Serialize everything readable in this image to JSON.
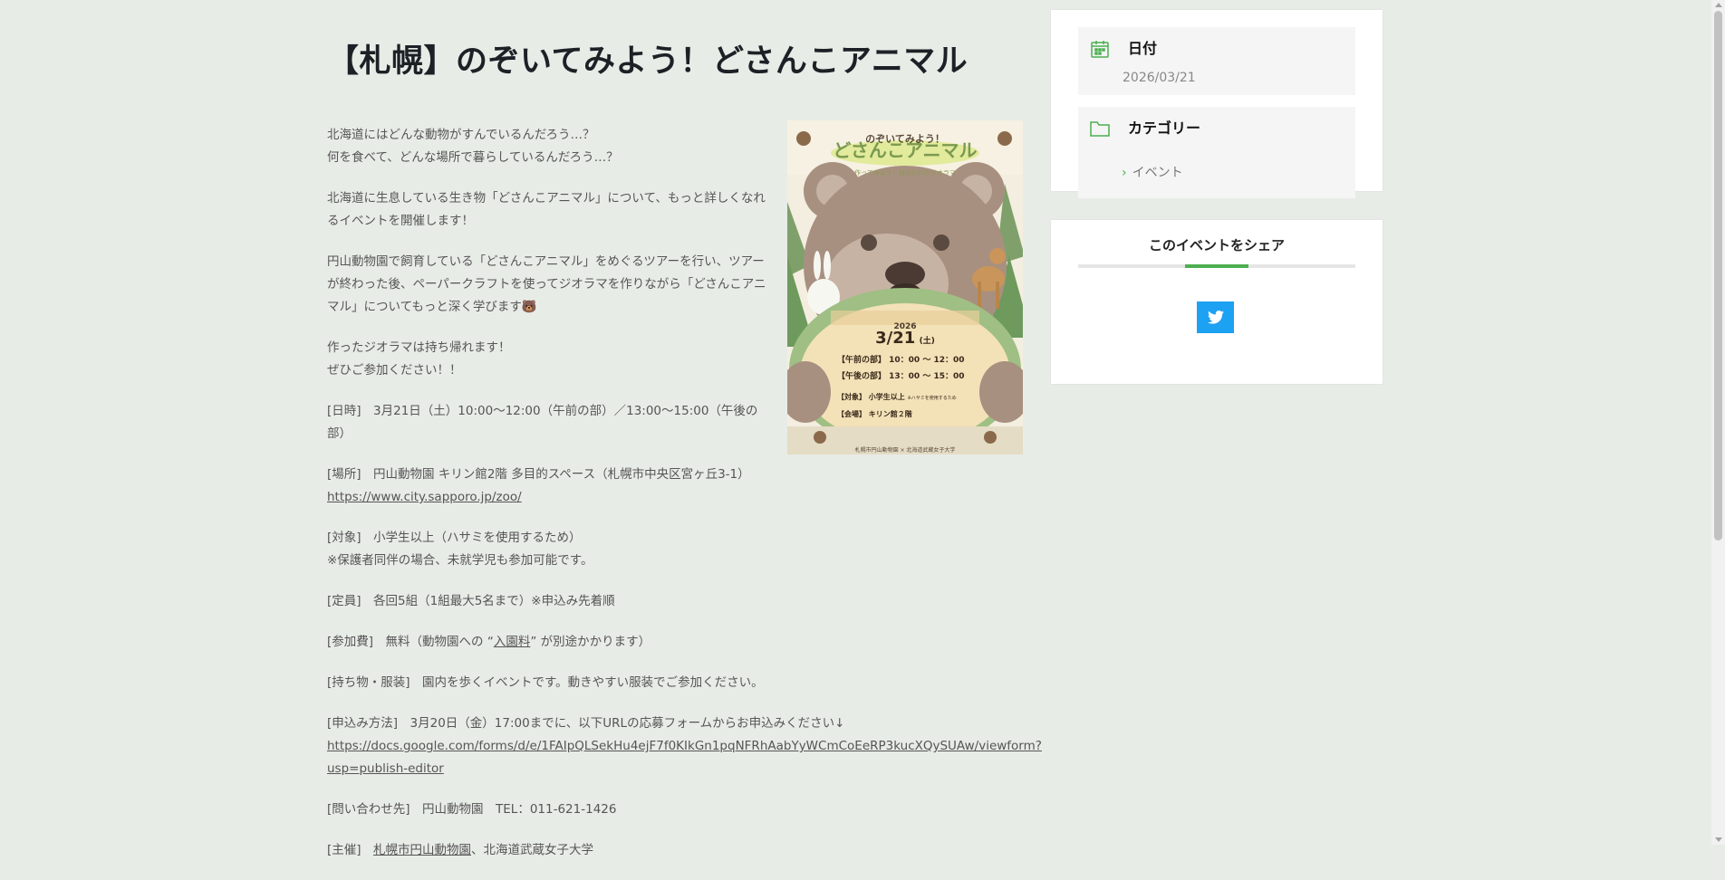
{
  "article": {
    "title": "【札幌】のぞいてみよう！どさんこアニマル",
    "paragraphs": {
      "p1": [
        "北海道にはどんな動物がすんでいるんだろう…？",
        "何を食べて、どんな場所で暮らしているんだろう…？"
      ],
      "p2": "北海道に生息している生き物「どさんこアニマル」について、もっと詳しくなれるイベントを開催します！",
      "p3": "円山動物園で飼育している「どさんこアニマル」をめぐるツアーを行い、ツアーが終わった後、ペーパークラフトを使ってジオラマを作りながら「どさんこアニマル」についてもっと深く学びます🐻",
      "p4": [
        "作ったジオラマは持ち帰れます！",
        "ぜひご参加ください！！"
      ],
      "date": "[日時]　3月21日（土）10:00〜12:00（午前の部）／13:00〜15:00（午後の部）",
      "place": "[場所]　円山動物園 キリン館2階 多目的スペース（札幌市中央区宮ヶ丘3-1）",
      "place_url": "https://www.city.sapporo.jp/zoo/",
      "target": [
        "[対象]　小学生以上（ハサミを使用するため）",
        "※保護者同伴の場合、未就学児も参加可能です。"
      ],
      "capacity": "[定員]　各回5組（1組最大5名まで）※申込み先着順",
      "fee_prefix": "[参加費]　無料（動物園への “",
      "fee_link": "入園料",
      "fee_suffix": "” が別途かかります）",
      "items": "[持ち物・服装]　園内を歩くイベントです。動きやすい服装でご参加ください。",
      "apply": "[申込み方法]　3月20日（金）17:00までに、以下URLの応募フォームからお申込みください↓",
      "apply_url": "https://docs.google.com/forms/d/e/1FAIpQLSekHu4ejF7f0KIkGn1pqNFRhAabYyWCmCoEeRP3kucXQySUAw/viewform?usp=publish-editor",
      "contact": "[問い合わせ先]　円山動物園　TEL：011-621-1426",
      "host_prefix": "[主催]　",
      "host_link": "札幌市円山動物園",
      "host_suffix": "、北海道武蔵女子大学"
    }
  },
  "poster": {
    "headline_small": "のぞいてみよう！",
    "headline_big": "どさんこアニマル",
    "tagline": "作ってみよう！自分だけのジオラマ",
    "year": "2026",
    "date": "3/21",
    "weekday": "(土)",
    "morning": "【午前の部】 10：00 〜 12：00",
    "afternoon": "【午後の部】 13：00 〜 15：00",
    "target": "【対象】 小学生以上",
    "target_note": "※ハサミを使用するため",
    "venue": "【会場】 キリン館２階",
    "footer": "札幌市円山動物園 × 北海道武蔵女子大学"
  },
  "sidebar": {
    "date_label": "日付",
    "date_value": "2026/03/21",
    "category_label": "カテゴリー",
    "category_item": "イベント",
    "share_title": "このイベントをシェア"
  },
  "colors": {
    "background": "#e8ece7",
    "accent_green": "#4caf50",
    "twitter_blue": "#1da1f2"
  },
  "icons": {
    "date": "calendar-icon",
    "category": "folder-icon",
    "share": "twitter-icon"
  }
}
